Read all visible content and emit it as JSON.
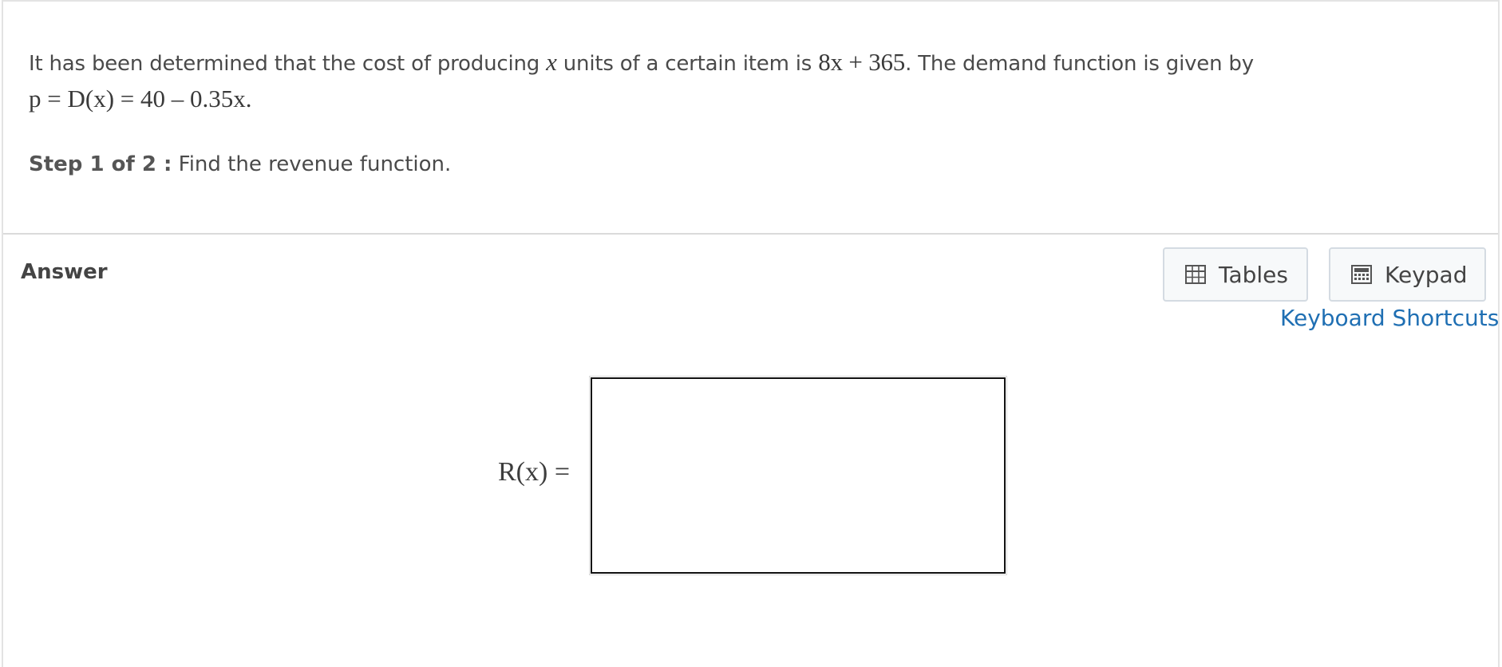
{
  "question": {
    "text_part1": "It has been determined that the cost of producing",
    "variable": "x",
    "text_part2": "units of a certain item is",
    "cost_expr": "8x + 365",
    "text_part3": ".  The demand function is given by",
    "demand_expr": "p = D(x) = 40 – 0.35x",
    "demand_end": "."
  },
  "step": {
    "label": "Step 1 of 2 :",
    "text": "Find the revenue function."
  },
  "answer": {
    "title": "Answer",
    "tables_label": "Tables",
    "keypad_label": "Keypad",
    "shortcuts_label": "Keyboard Shortcuts",
    "function_label": "R(x) =",
    "input_value": ""
  },
  "icons": {
    "tables": "table-icon",
    "keypad": "calculator-icon"
  }
}
